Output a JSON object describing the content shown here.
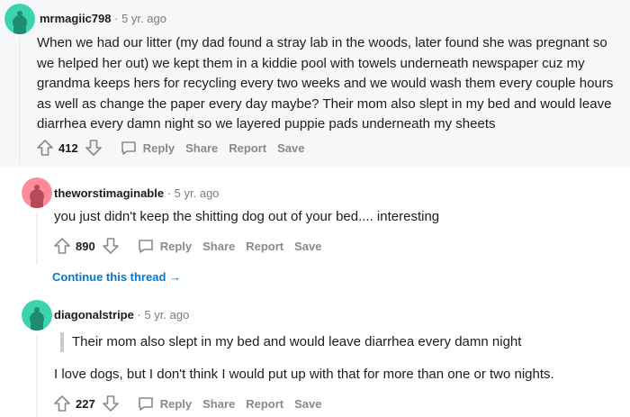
{
  "comments": [
    {
      "username": "mrmagiic798",
      "separator": "·",
      "time": "5 yr. ago",
      "avatar_color": "#3bd4ae",
      "body": "When we had our litter (my dad found a stray lab in the woods, later found she was pregnant so we helped her out) we kept them in a kiddie pool with towels underneath newspaper cuz my grandma keeps hers for recycling every two weeks and we would wash them every couple hours as well as change the paper every day maybe? Their mom also slept in my bed and would leave diarrhea every damn night so we layered puppie pads underneath my sheets",
      "score": "412",
      "actions": [
        "Reply",
        "Share",
        "Report",
        "Save"
      ]
    },
    {
      "username": "theworstimaginable",
      "separator": "·",
      "time": "5 yr. ago",
      "avatar_color": "#ff8a9b",
      "body": "you just didn't keep the shitting dog out of your bed.... interesting",
      "score": "890",
      "actions": [
        "Reply",
        "Share",
        "Report",
        "Save"
      ]
    },
    {
      "username": "diagonalstripe",
      "separator": "·",
      "time": "5 yr. ago",
      "avatar_color": "#3bd4ae",
      "quote": "Their mom also slept in my bed and would leave diarrhea every damn night",
      "body": "I love dogs, but I don't think I would put up with that for more than one or two nights.",
      "score": "227",
      "actions": [
        "Reply",
        "Share",
        "Report",
        "Save"
      ]
    }
  ],
  "continue_thread": "Continue this thread",
  "continue_arrow": "→",
  "colors": {
    "top_background": "#f6f7f8",
    "link": "#0079d3",
    "muted": "#878a8c",
    "text": "#1c1c1c"
  }
}
